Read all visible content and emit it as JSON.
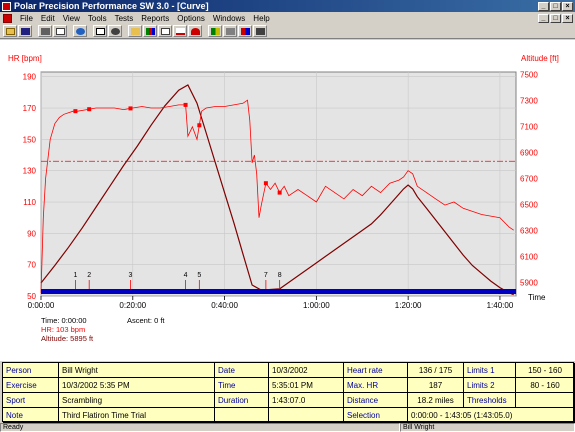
{
  "window": {
    "title": "Polar Precision Performance SW 3.0 - [Curve]"
  },
  "menu": {
    "items": [
      "File",
      "Edit",
      "View",
      "Tools",
      "Tests",
      "Reports",
      "Options",
      "Windows",
      "Help"
    ]
  },
  "toolbar": {
    "icons": [
      "open-icon",
      "save-icon",
      "cut-icon",
      "copy-icon",
      "globe-icon",
      "calendar-icon",
      "sync-icon",
      "folder-icon",
      "bar-chart-icon",
      "table-icon",
      "curve-icon",
      "person-icon",
      "bar-chart-icon",
      "table-icon",
      "bar-chart-icon",
      "table-icon"
    ]
  },
  "chart_data": {
    "type": "line",
    "ylabel_left": "HR [bpm]",
    "ylabel_right": "Altitude [ft]",
    "xlabel": "Time",
    "x_ticks": [
      "0:00:00",
      "0:20:00",
      "0:40:00",
      "1:00:00",
      "1:20:00",
      "1:40:00"
    ],
    "hr_ticks": [
      190,
      170,
      150,
      130,
      110,
      90,
      70,
      50
    ],
    "alt_ticks": [
      7500,
      7300,
      7100,
      6900,
      6700,
      6500,
      6300,
      6100,
      5900
    ],
    "hr_range": [
      50,
      193
    ],
    "alt_range": [
      5795,
      7520
    ],
    "lap_markers": [
      {
        "label": "1",
        "t": 7.5
      },
      {
        "label": "2",
        "t": 10.5
      },
      {
        "label": "3",
        "t": 19.5
      },
      {
        "label": "4",
        "t": 31.5
      },
      {
        "label": "5",
        "t": 34.5
      },
      {
        "label": "7",
        "t": 49
      },
      {
        "label": "8",
        "t": 52
      }
    ],
    "threshold_hr": 136,
    "series": [
      {
        "name": "HR",
        "color": "#ff0000",
        "t": [
          0,
          0.5,
          1,
          2,
          3,
          4,
          5,
          6,
          7,
          8,
          10,
          12,
          14,
          16,
          18,
          20,
          22,
          24,
          26,
          28,
          30,
          31.5,
          32,
          33,
          34,
          35,
          36,
          38,
          40,
          42,
          44,
          45,
          45.5,
          46,
          46.5,
          47,
          47.5,
          48,
          49,
          50,
          51,
          52,
          53,
          54,
          56,
          58,
          60,
          62,
          64,
          66,
          68,
          70,
          72,
          74,
          76,
          78,
          79,
          80,
          81,
          82,
          84,
          86,
          88,
          90,
          92,
          94,
          96,
          98,
          100,
          102,
          103
        ],
        "v": [
          52,
          100,
          125,
          150,
          160,
          164,
          166,
          167,
          168,
          168,
          169,
          170,
          170,
          170,
          169,
          170,
          171,
          170,
          170,
          171,
          172,
          172,
          152,
          158,
          150,
          168,
          170,
          171,
          171,
          172,
          173,
          175,
          162,
          135,
          140,
          128,
          100,
          108,
          122,
          118,
          122,
          116,
          120,
          114,
          118,
          114,
          110,
          120,
          116,
          112,
          118,
          114,
          120,
          116,
          122,
          124,
          126,
          130,
          128,
          120,
          116,
          112,
          108,
          110,
          106,
          104,
          102,
          101,
          100,
          94,
          92
        ]
      },
      {
        "name": "Altitude",
        "color": "#800000",
        "t": [
          0,
          3,
          6,
          9,
          12,
          15,
          18,
          21,
          24,
          27,
          30,
          32,
          34,
          36,
          38,
          40,
          42,
          44,
          46,
          48,
          50,
          52,
          54,
          56,
          58,
          60,
          62,
          64,
          66,
          68,
          70,
          72,
          74,
          76,
          78,
          79,
          80,
          81,
          82,
          84,
          86,
          88,
          90,
          92,
          94,
          96,
          98,
          100,
          102,
          103
        ],
        "v": [
          5895,
          6030,
          6170,
          6320,
          6480,
          6640,
          6800,
          6950,
          7110,
          7260,
          7380,
          7420,
          7280,
          7050,
          6820,
          6590,
          6360,
          6120,
          5880,
          5840,
          5845,
          5850,
          5900,
          5950,
          6000,
          6050,
          6100,
          6150,
          6200,
          6250,
          6300,
          6350,
          6420,
          6500,
          6580,
          6620,
          6650,
          6620,
          6560,
          6470,
          6380,
          6290,
          6200,
          6110,
          6030,
          5970,
          5910,
          5860,
          5820,
          5805
        ]
      }
    ]
  },
  "info": {
    "time_label": "Time: 0:00:00",
    "hr_label": "HR: 103 bpm",
    "altitude_label": "Altitude: 5895 ft",
    "ascent_label": "Ascent: 0 ft"
  },
  "summary": {
    "person_label": "Person",
    "person": "Bill Wright",
    "date_label": "Date",
    "date": "10/3/2002",
    "heartrate_label": "Heart rate",
    "heartrate": "136 / 175",
    "limits1_label": "Limits 1",
    "limits1": "150 - 160",
    "exercise_label": "Exercise",
    "exercise": "10/3/2002 5:35 PM",
    "time_label": "Time",
    "time": "5:35:01 PM",
    "maxhr_label": "Max. HR",
    "maxhr": "187",
    "limits2_label": "Limits 2",
    "limits2": "80 - 160",
    "sport_label": "Sport",
    "sport": "Scrambling",
    "duration_label": "Duration",
    "duration": "1:43:07.0",
    "distance_label": "Distance",
    "distance": "18.2 miles",
    "thresholds_label": "Thresholds",
    "thresholds": "",
    "note_label": "Note",
    "note": "Third Flatiron Time Trial",
    "selection_label": "Selection",
    "selection": "0:00:00 - 1:43:05 (1:43:05.0)"
  },
  "status": {
    "left": "Ready",
    "right": "Bill Wright"
  }
}
